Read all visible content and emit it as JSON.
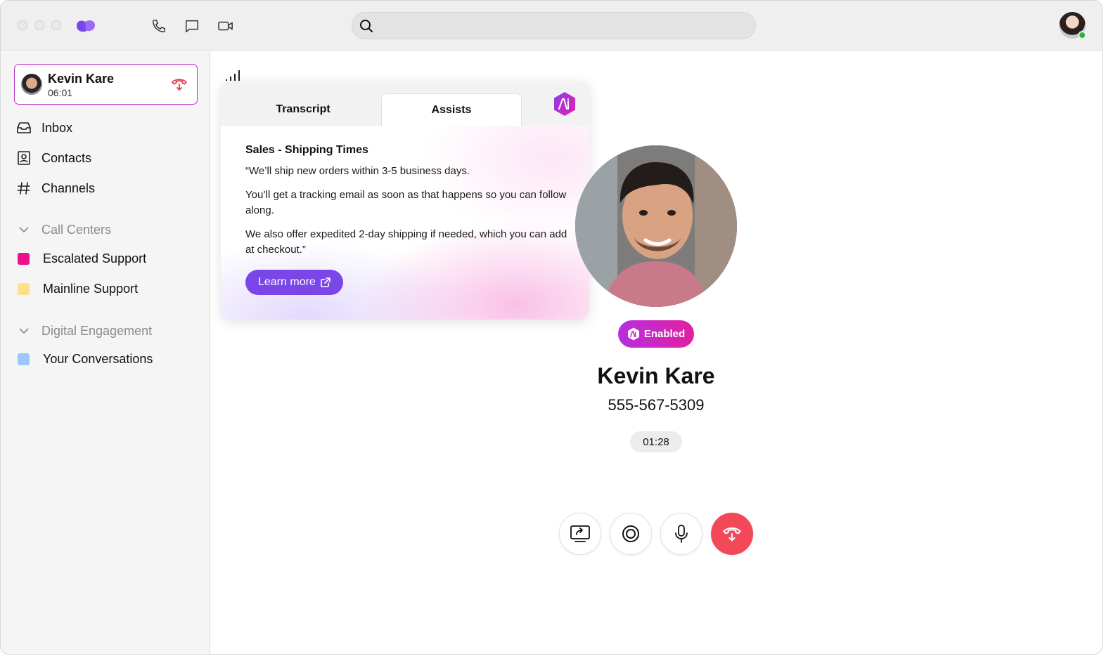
{
  "search": {
    "placeholder": ""
  },
  "active_call": {
    "name": "Kevin Kare",
    "duration": "06:01"
  },
  "nav": [
    {
      "label": "Inbox",
      "icon": "inbox-icon"
    },
    {
      "label": "Contacts",
      "icon": "contacts-icon"
    },
    {
      "label": "Channels",
      "icon": "hash-icon"
    }
  ],
  "sections": {
    "call_centers": {
      "label": "Call Centers",
      "items": [
        {
          "label": "Escalated Support",
          "color": "#ec0f8c"
        },
        {
          "label": "Mainline Support",
          "color": "#fde08a"
        }
      ]
    },
    "digital_engagement": {
      "label": "Digital Engagement",
      "items": [
        {
          "label": "Your Conversations",
          "color": "#9cc7fb"
        }
      ]
    }
  },
  "assist_panel": {
    "tabs": [
      "Transcript",
      "Assists"
    ],
    "active_tab": "Assists",
    "title": "Sales - Shipping Times",
    "paragraphs": [
      "“We’ll ship new orders within 3-5 business days.",
      "You’ll get a tracking email as soon as that happens so you can follow along.",
      "We also offer expedited 2-day shipping if needed, which you can add at checkout.”"
    ],
    "button_label": "Learn more"
  },
  "contact": {
    "badge": "Enabled",
    "name": "Kevin Kare",
    "phone": "555-567-5309",
    "call_timer": "01:28"
  },
  "colors": {
    "accent": "#7b46e8",
    "end_call": "#f24857",
    "badge_start": "#b62fe0",
    "badge_end": "#e21fa0"
  }
}
